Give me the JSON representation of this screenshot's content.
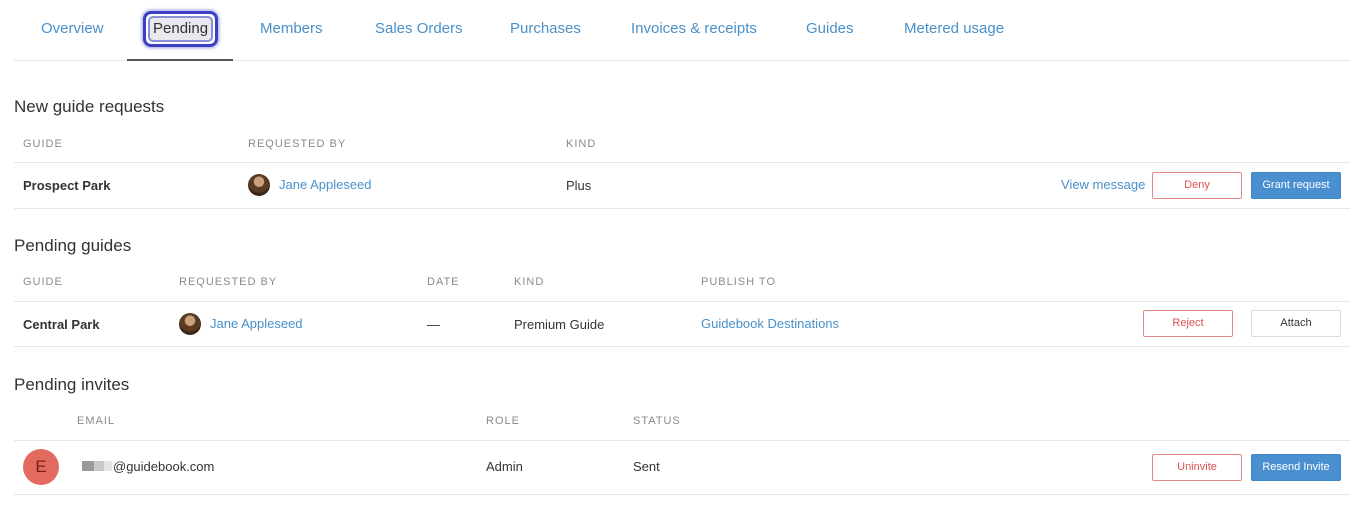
{
  "tabs": [
    {
      "label": "Overview"
    },
    {
      "label": "Pending"
    },
    {
      "label": "Members"
    },
    {
      "label": "Sales Orders"
    },
    {
      "label": "Purchases"
    },
    {
      "label": "Invoices & receipts"
    },
    {
      "label": "Guides"
    },
    {
      "label": "Metered usage"
    }
  ],
  "active_tab": "Pending",
  "new_requests": {
    "title": "New guide requests",
    "headers": {
      "guide": "GUIDE",
      "requested_by": "REQUESTED BY",
      "kind": "KIND"
    },
    "rows": [
      {
        "guide": "Prospect Park",
        "requested_by": "Jane Appleseed",
        "kind": "Plus",
        "view_message": "View message",
        "deny": "Deny",
        "grant": "Grant request"
      }
    ]
  },
  "pending_guides": {
    "title": "Pending guides",
    "headers": {
      "guide": "GUIDE",
      "requested_by": "REQUESTED BY",
      "date": "DATE",
      "kind": "KIND",
      "publish_to": "PUBLISH TO"
    },
    "rows": [
      {
        "guide": "Central Park",
        "requested_by": "Jane Appleseed",
        "date": "—",
        "kind": "Premium Guide",
        "publish_to": "Guidebook Destinations",
        "reject": "Reject",
        "attach": "Attach"
      }
    ]
  },
  "pending_invites": {
    "title": "Pending invites",
    "headers": {
      "email": "EMAIL",
      "role": "ROLE",
      "status": "STATUS"
    },
    "rows": [
      {
        "avatar_letter": "E",
        "email": "@guidebook.com",
        "role": "Admin",
        "status": "Sent",
        "uninvite": "Uninvite",
        "resend": "Resend Invite"
      }
    ]
  },
  "colors": {
    "link": "#4a90c8",
    "primary": "#4a90d0",
    "danger": "#d9534f",
    "avatar_bg": "#e36a5f",
    "focus_ring": "#3a3fc4"
  }
}
